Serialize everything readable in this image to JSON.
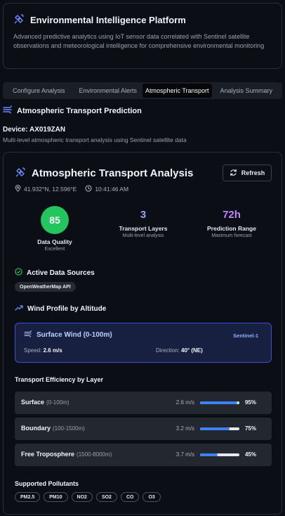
{
  "header": {
    "title": "Environmental Intelligence Platform",
    "description": "Advanced predictive analytics using IoT sensor data correlated with Sentinel satellite observations and meteorological intelligence for comprehensive environmental monitoring"
  },
  "tabs": [
    {
      "label": "Configure Analysis",
      "active": false
    },
    {
      "label": "Environmental Alerts",
      "active": false
    },
    {
      "label": "Atmospheric Transport",
      "active": true
    },
    {
      "label": "Analysis Summary",
      "active": false
    }
  ],
  "section": {
    "title": "Atmospheric Transport Prediction"
  },
  "device": {
    "label": "Device: AX019ZAN",
    "description": "Multi-level atmospheric transport analysis using Sentinel satellite data"
  },
  "analysis": {
    "title": "Atmospheric Transport Analysis",
    "refresh_label": "Refresh",
    "coordinates": "41.932°N, 12.596°E",
    "time": "10:41:46 AM",
    "quality": {
      "value": "85",
      "label": "Data Quality",
      "sub": "Excellent",
      "color": "#22c55e"
    },
    "layers_stat": {
      "value": "3",
      "label": "Transport Layers",
      "sub": "Multi-level analysis",
      "color": "#93a5ff"
    },
    "range_stat": {
      "value": "72h",
      "label": "Prediction Range",
      "sub": "Maximum forecast",
      "color": "#c084fc"
    }
  },
  "sources": {
    "heading": "Active Data Sources",
    "items": [
      "OpenWeatherMap API"
    ]
  },
  "wind_profile": {
    "heading": "Wind Profile by Altitude",
    "title": "Surface Wind (0-100m)",
    "source": "Sentinel-1",
    "speed_label": "Speed:",
    "speed_value": "2.6 m/s",
    "direction_label": "Direction:",
    "direction_value": "40° (NE)"
  },
  "efficiency": {
    "heading": "Transport Efficiency by Layer",
    "layers": [
      {
        "name": "Surface",
        "range": "(0-100m)",
        "speed": "2.6 m/s",
        "percent": "95%",
        "fraction": 0.95
      },
      {
        "name": "Boundary",
        "range": "(100-1500m)",
        "speed": "3.2 m/s",
        "percent": "75%",
        "fraction": 0.75
      },
      {
        "name": "Free Troposphere",
        "range": "(1500-8000m)",
        "speed": "3.7 m/s",
        "percent": "45%",
        "fraction": 0.45
      }
    ]
  },
  "pollutants": {
    "heading": "Supported Pollutants",
    "items": [
      "PM2.5",
      "PM10",
      "NO2",
      "SO2",
      "CO",
      "O3"
    ]
  },
  "colors": {
    "accent": "#3b82f6",
    "wind_card_border": "#3b4fd9",
    "background": "#0b0e14"
  }
}
